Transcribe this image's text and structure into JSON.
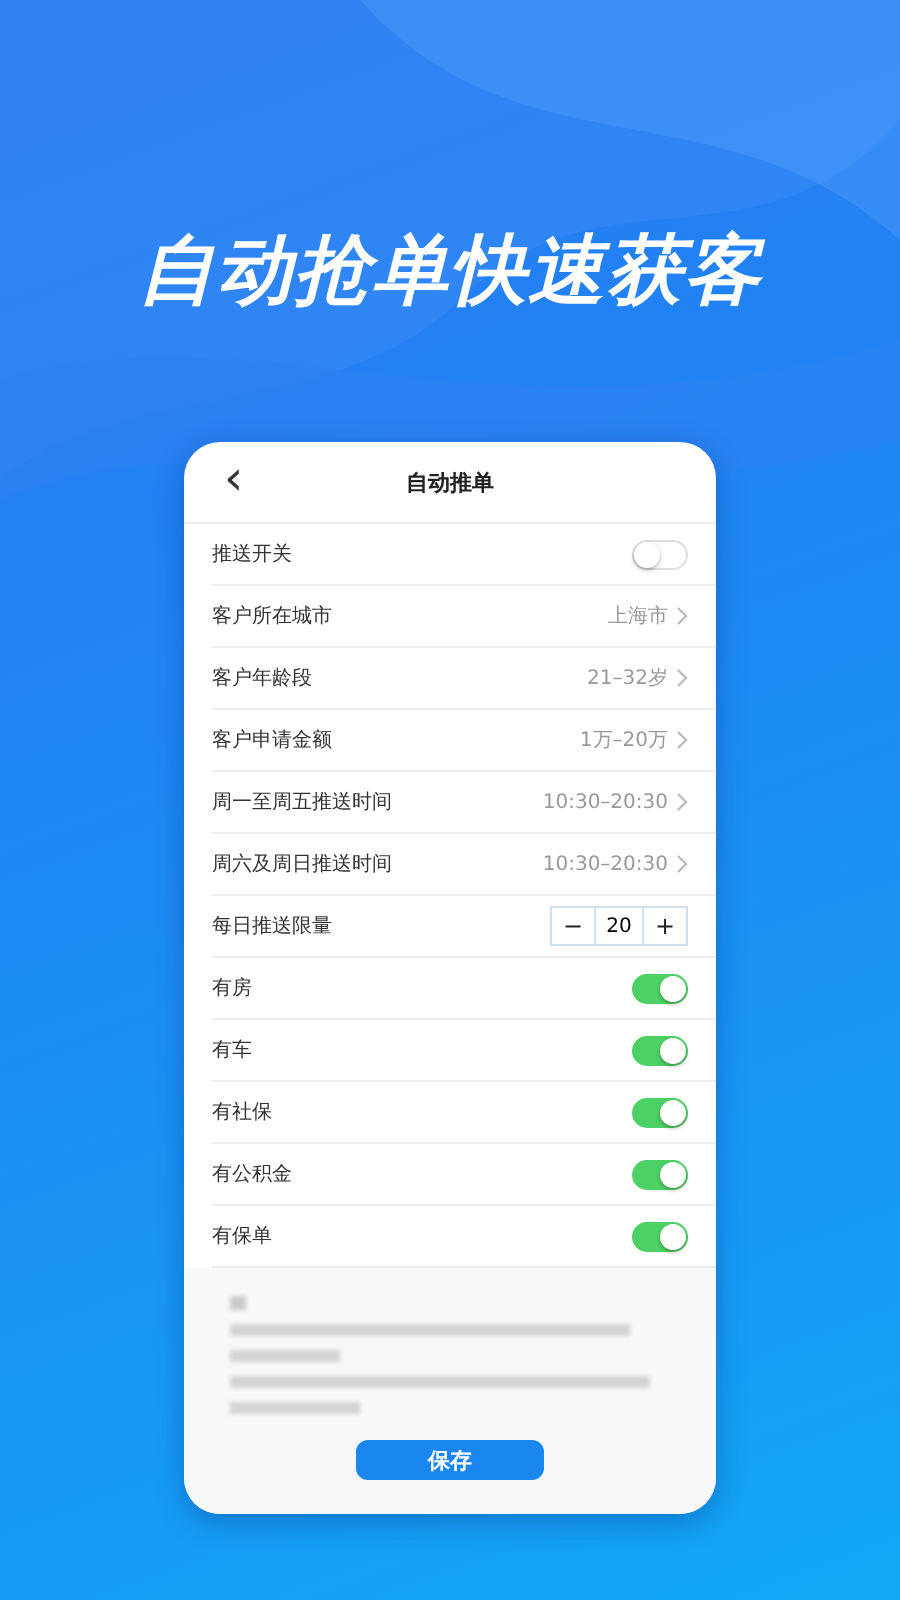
{
  "headline": "自动抢单快速获客",
  "screen": {
    "title": "自动推单",
    "back": "‹",
    "rows": [
      {
        "kind": "toggle",
        "label": "推送开关",
        "on": false
      },
      {
        "kind": "select",
        "label": "客户所在城市",
        "value": "上海市"
      },
      {
        "kind": "select",
        "label": "客户年龄段",
        "value": "21–32岁"
      },
      {
        "kind": "select",
        "label": "客户申请金额",
        "value": "1万–20万"
      },
      {
        "kind": "select",
        "label": "周一至周五推送时间",
        "value": "10:30–20:30"
      },
      {
        "kind": "select",
        "label": "周六及周日推送时间",
        "value": "10:30–20:30"
      },
      {
        "kind": "stepper",
        "label": "每日推送限量",
        "value": "20",
        "minus": "−",
        "plus": "+"
      },
      {
        "kind": "toggle",
        "label": "有房",
        "on": true
      },
      {
        "kind": "toggle",
        "label": "有车",
        "on": true
      },
      {
        "kind": "toggle",
        "label": "有社保",
        "on": true
      },
      {
        "kind": "toggle",
        "label": "有公积金",
        "on": true
      },
      {
        "kind": "toggle",
        "label": "有保单",
        "on": true
      }
    ],
    "save": "保存"
  }
}
